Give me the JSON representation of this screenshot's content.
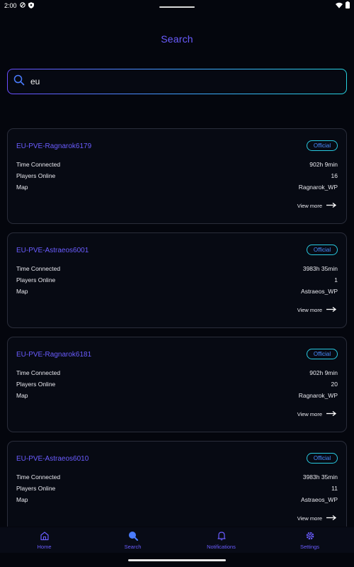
{
  "status": {
    "time": "2:00"
  },
  "page": {
    "title": "Search"
  },
  "search": {
    "value": "eu"
  },
  "servers": [
    {
      "name": "EU-PVE-Ragnarok6179",
      "badge": "Official",
      "rows": [
        {
          "label": "Time Connected",
          "value": "902h 9min"
        },
        {
          "label": "Players Online",
          "value": "16"
        },
        {
          "label": "Map",
          "value": "Ragnarok_WP"
        }
      ],
      "view_more": "View more"
    },
    {
      "name": "EU-PVE-Astraeos6001",
      "badge": "Official",
      "rows": [
        {
          "label": "Time Connected",
          "value": "3983h 35min"
        },
        {
          "label": "Players Online",
          "value": "1"
        },
        {
          "label": "Map",
          "value": "Astraeos_WP"
        }
      ],
      "view_more": "View more"
    },
    {
      "name": "EU-PVE-Ragnarok6181",
      "badge": "Official",
      "rows": [
        {
          "label": "Time Connected",
          "value": "902h 9min"
        },
        {
          "label": "Players Online",
          "value": "20"
        },
        {
          "label": "Map",
          "value": "Ragnarok_WP"
        }
      ],
      "view_more": "View more"
    },
    {
      "name": "EU-PVE-Astraeos6010",
      "badge": "Official",
      "rows": [
        {
          "label": "Time Connected",
          "value": "3983h 35min"
        },
        {
          "label": "Players Online",
          "value": "11"
        },
        {
          "label": "Map",
          "value": "Astraeos_WP"
        }
      ],
      "view_more": "View more"
    }
  ],
  "nav": [
    {
      "label": "Home",
      "icon": "home-icon"
    },
    {
      "label": "Search",
      "icon": "search-icon",
      "active": true
    },
    {
      "label": "Notifications",
      "icon": "bell-icon"
    },
    {
      "label": "Settings",
      "icon": "gear-icon"
    }
  ],
  "colors": {
    "accent": "#6a5cff",
    "badge_border": "#28c9e0",
    "background": "#04060d"
  }
}
